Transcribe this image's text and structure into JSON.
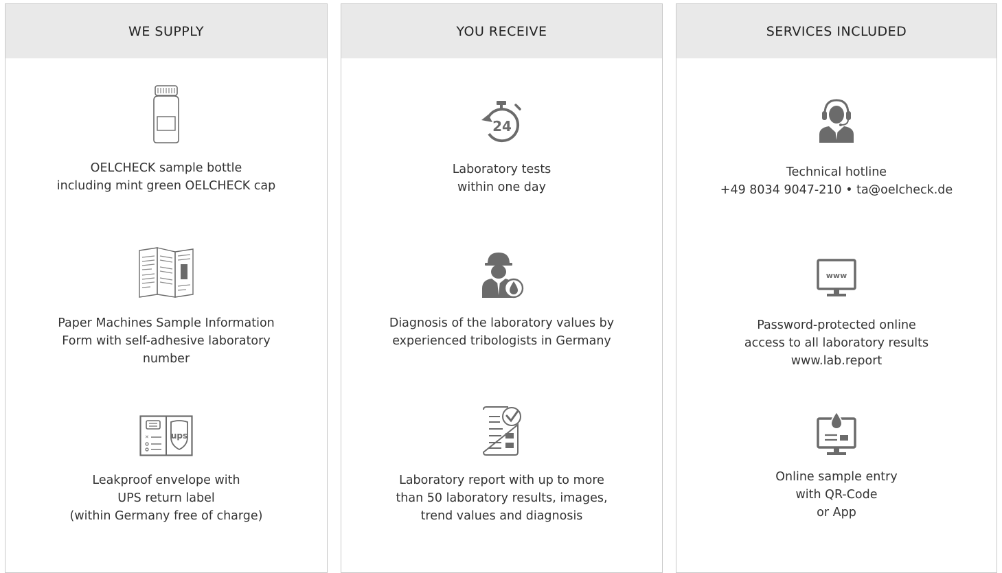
{
  "columns": [
    {
      "title": "WE SUPPLY",
      "items": [
        {
          "icon": "sample-bottle-icon",
          "lines": [
            "OELCHECK sample bottle",
            "including mint green OELCHECK cap"
          ]
        },
        {
          "icon": "folded-form-icon",
          "lines": [
            "Paper Machines Sample Information",
            "Form with self-adhesive laboratory",
            "number"
          ]
        },
        {
          "icon": "envelope-ups-icon",
          "lines": [
            "Leakproof envelope with",
            "UPS return label",
            "(within Germany free of charge)"
          ]
        }
      ]
    },
    {
      "title": "YOU RECEIVE",
      "items": [
        {
          "icon": "stopwatch-24-icon",
          "badge": "24",
          "lines": [
            "Laboratory tests",
            "within one day"
          ]
        },
        {
          "icon": "tribologist-icon",
          "lines": [
            "Diagnosis of the laboratory values by",
            "experienced tribologists in Germany"
          ]
        },
        {
          "icon": "lab-report-icon",
          "lines": [
            "Laboratory report with up to more",
            "than 50 laboratory results, images,",
            "trend values and diagnosis"
          ]
        }
      ]
    },
    {
      "title": "SERVICES INCLUDED",
      "items": [
        {
          "icon": "hotline-agent-icon",
          "lines": [
            "Technical hotline",
            "+49 8034 9047-210 • ta@oelcheck.de"
          ]
        },
        {
          "icon": "www-monitor-icon",
          "badge": "www",
          "lines": [
            "Password-protected online",
            "access to all laboratory results",
            "www.lab.report"
          ]
        },
        {
          "icon": "online-entry-monitor-icon",
          "lines": [
            "Online sample entry",
            "with QR-Code",
            "or App"
          ]
        }
      ]
    }
  ],
  "colors": {
    "header_bg": "#e9e9e9",
    "border": "#c8c8c8",
    "icon": "#6b6b6b",
    "text": "#333333"
  }
}
